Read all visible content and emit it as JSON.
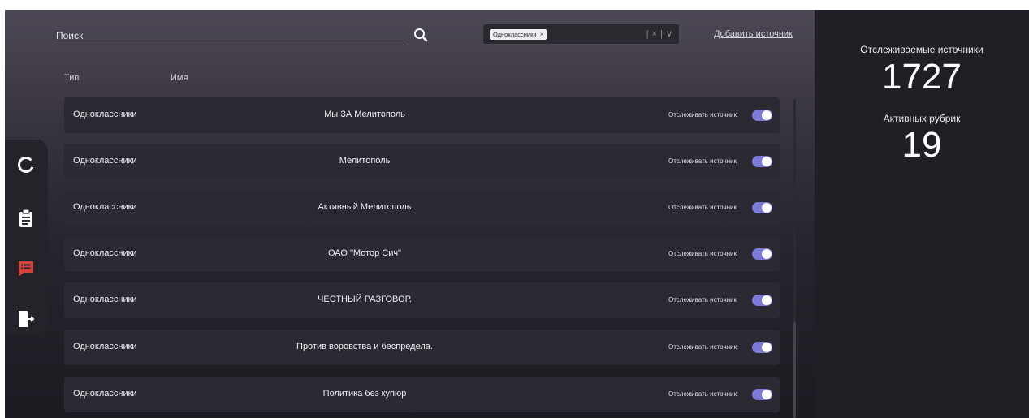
{
  "search": {
    "placeholder": "Поиск",
    "icon": "search-icon"
  },
  "filter": {
    "chip": "Одноклассники",
    "chip_remove": "×",
    "clear": "×",
    "chevron": "∨",
    "separator": "|"
  },
  "add_source": "Добавить источник",
  "columns": {
    "type": "Тип",
    "name": "Имя"
  },
  "rows": [
    {
      "type": "Одноклассники",
      "name": "Мы ЗА Мелитополь",
      "track_label": "Отслеживать источник",
      "tracked": true
    },
    {
      "type": "Одноклассники",
      "name": "Мелитополь",
      "track_label": "Отслеживать источник",
      "tracked": true
    },
    {
      "type": "Одноклассники",
      "name": "Активный Мелитополь",
      "track_label": "Отслеживать источник",
      "tracked": true
    },
    {
      "type": "Одноклассники",
      "name": "ОАО \"Мотор Сич\"",
      "track_label": "Отслеживать источник",
      "tracked": true
    },
    {
      "type": "Одноклассники",
      "name": "ЧЕСТНЫЙ РАЗГОВОР.",
      "track_label": "Отслеживать источник",
      "tracked": true
    },
    {
      "type": "Одноклассники",
      "name": "Против воровства и беспредела.",
      "track_label": "Отслеживать источник",
      "tracked": true
    },
    {
      "type": "Одноклассники",
      "name": "Политика без купюр",
      "track_label": "Отслеживать источник",
      "tracked": true
    }
  ],
  "stats": {
    "tracked_sources_label": "Отслеживаемые источники",
    "tracked_sources_value": "1727",
    "active_rubrics_label": "Активных рубрик",
    "active_rubrics_value": "19"
  },
  "nav": [
    {
      "icon": "loading-ring-icon",
      "active": false
    },
    {
      "icon": "clipboard-icon",
      "active": false
    },
    {
      "icon": "feed-list-icon",
      "active": true
    },
    {
      "icon": "logout-icon",
      "active": false
    }
  ],
  "colors": {
    "accent": "#7b7ad6",
    "active_nav": "#d0453b",
    "row_bg": "#2c2933",
    "panel_bg": "#211f25"
  }
}
